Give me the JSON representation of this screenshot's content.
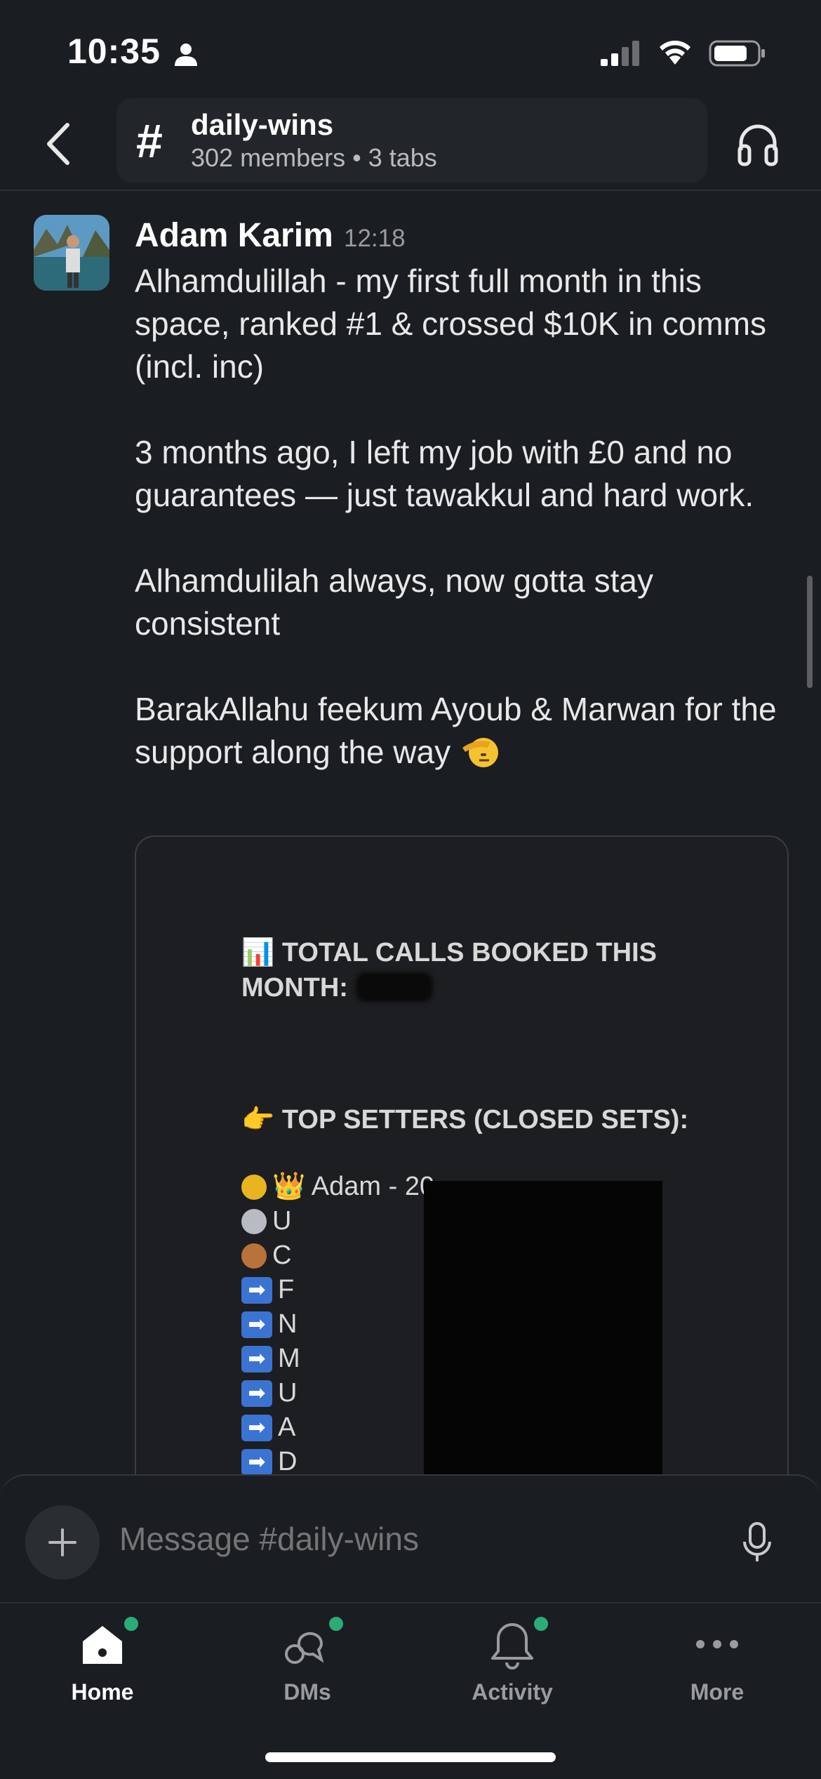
{
  "status_bar": {
    "time": "10:35"
  },
  "header": {
    "channel_name": "daily-wins",
    "channel_meta": "302 members • 3 tabs",
    "hash_symbol": "#"
  },
  "message": {
    "author": "Adam Karim",
    "timestamp": "12:18",
    "paragraphs": [
      "Alhamdulillah - my first full month in this space, ranked #1 & crossed $10K in comms (incl. inc)",
      "3 months ago, I left my job with £0 and no guarantees — just tawakkul and hard work.",
      "Alhamdulilah always, now gotta stay consistent",
      "BarakAllahu feekum Ayoub & Marwan for the support along the way"
    ]
  },
  "attachment": {
    "title": "📊 TOTAL CALLS BOOKED THIS MONTH:",
    "subtitle": "👉 TOP SETTERS (CLOSED SETS):",
    "ranks": [
      {
        "icon": "gold-medal",
        "text": "👑 Adam - 20"
      },
      {
        "icon": "silver-medal",
        "text": "U"
      },
      {
        "icon": "bronze-medal",
        "text": "C"
      },
      {
        "icon": "arrow",
        "text": "F"
      },
      {
        "icon": "arrow",
        "text": "N"
      },
      {
        "icon": "arrow",
        "text": "M"
      },
      {
        "icon": "arrow",
        "text": "U"
      },
      {
        "icon": "arrow",
        "text": "A"
      },
      {
        "icon": "arrow",
        "text": "D"
      }
    ]
  },
  "composer": {
    "placeholder": "Message #daily-wins"
  },
  "tabs": [
    {
      "label": "Home",
      "active": true,
      "badge": true
    },
    {
      "label": "DMs",
      "active": false,
      "badge": true
    },
    {
      "label": "Activity",
      "active": false,
      "badge": true
    },
    {
      "label": "More",
      "active": false,
      "badge": false
    }
  ],
  "colors": {
    "background": "#1a1d21",
    "badge": "#2bac76",
    "accent_arrow": "#3b73d3"
  }
}
